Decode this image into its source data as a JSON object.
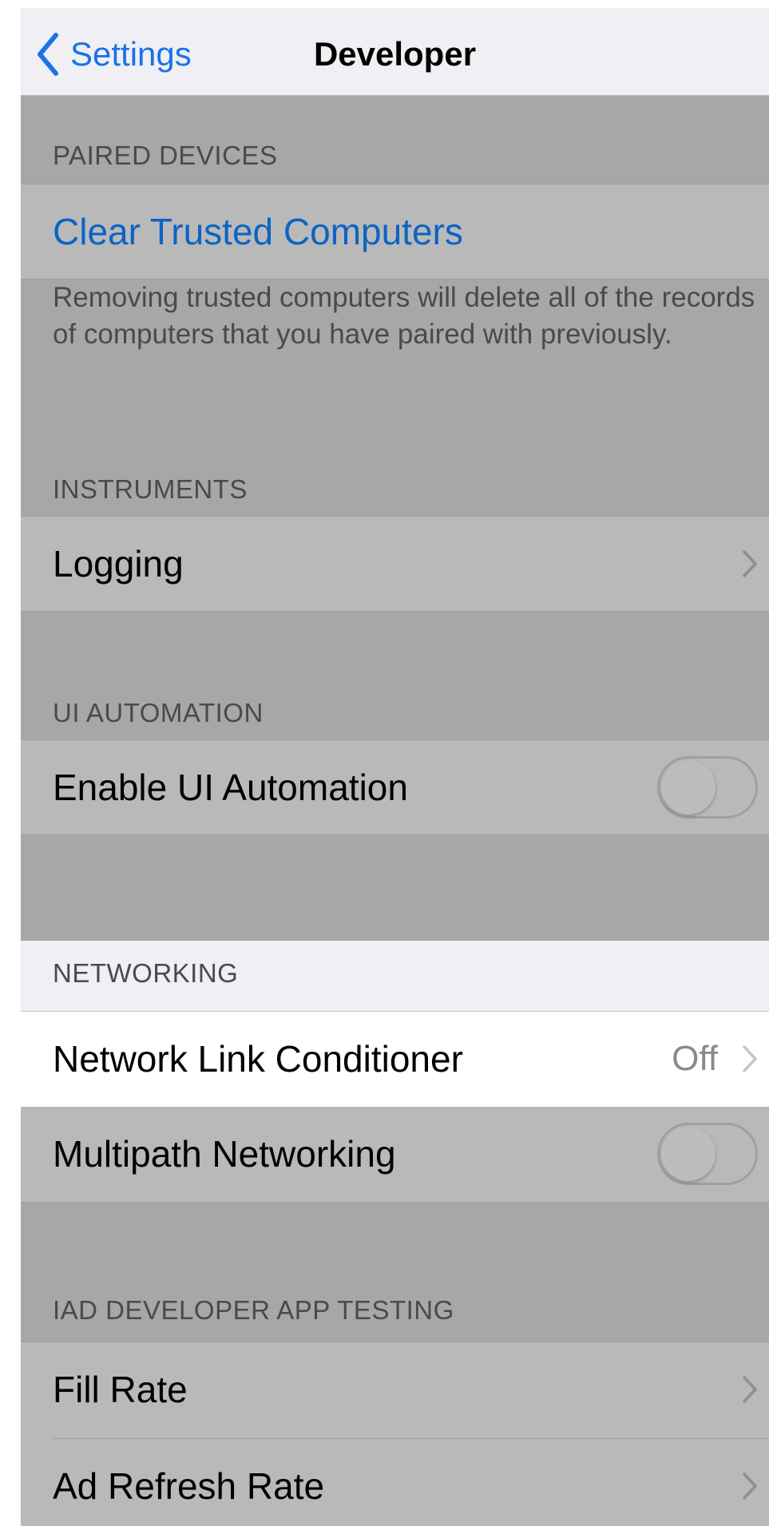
{
  "navbar": {
    "back_label": "Settings",
    "title": "Developer"
  },
  "sections": {
    "paired_devices": {
      "header": "PAIRED DEVICES",
      "clear_label": "Clear Trusted Computers",
      "footer": "Removing trusted computers will delete all of the records of computers that you have paired with previously."
    },
    "instruments": {
      "header": "INSTRUMENTS",
      "logging_label": "Logging"
    },
    "ui_automation": {
      "header": "UI AUTOMATION",
      "enable_label": "Enable UI Automation"
    },
    "networking": {
      "header": "NETWORKING",
      "nlc_label": "Network Link Conditioner",
      "nlc_value": "Off",
      "multipath_label": "Multipath Networking"
    },
    "iad": {
      "header": "IAD DEVELOPER APP TESTING",
      "fill_rate_label": "Fill Rate",
      "ad_refresh_label": "Ad Refresh Rate"
    }
  },
  "toggles": {
    "enable_ui_automation": false,
    "multipath_networking": false
  },
  "colors": {
    "accent": "#1a73e8",
    "link": "#0c64c4",
    "dimmed_background": "#a7a7aa",
    "cell_dimmed": "#b9b9ba",
    "highlight": "#ffffff"
  }
}
